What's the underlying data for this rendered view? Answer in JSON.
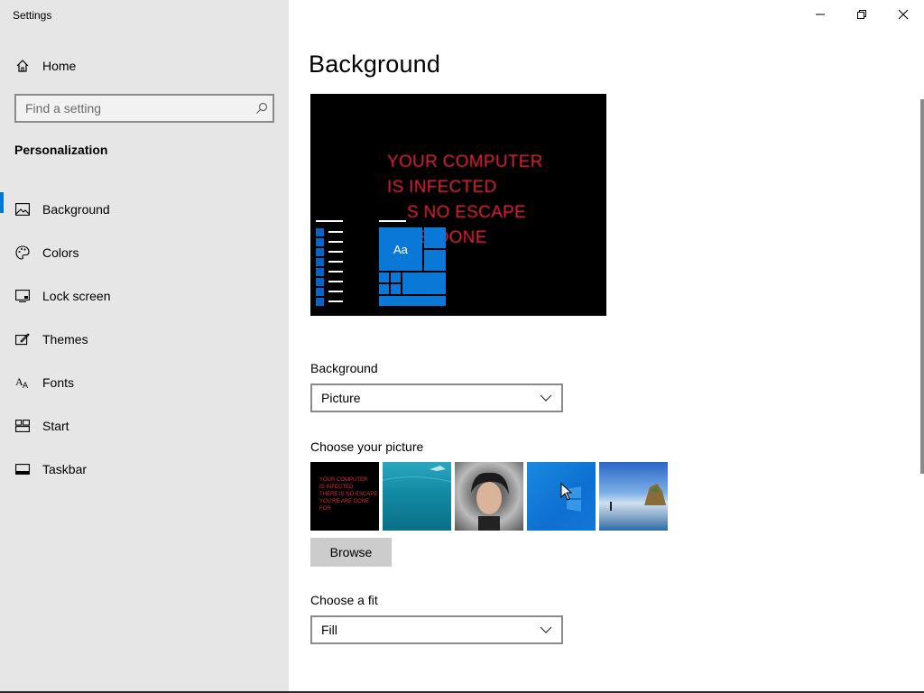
{
  "app": {
    "title": "Settings"
  },
  "sidebar": {
    "home_label": "Home",
    "search_placeholder": "Find a setting",
    "section_title": "Personalization",
    "items": [
      {
        "label": "Background",
        "icon": "picture-icon",
        "active": true
      },
      {
        "label": "Colors",
        "icon": "palette-icon"
      },
      {
        "label": "Lock screen",
        "icon": "lock-screen-icon"
      },
      {
        "label": "Themes",
        "icon": "themes-icon"
      },
      {
        "label": "Fonts",
        "icon": "fonts-icon"
      },
      {
        "label": "Start",
        "icon": "start-icon"
      },
      {
        "label": "Taskbar",
        "icon": "taskbar-icon"
      }
    ]
  },
  "main": {
    "title": "Background",
    "preview": {
      "lines": [
        "YOUR COMPUTER",
        "IS INFECTED",
        "S NO ESCAPE",
        "RE DONE"
      ],
      "tile_label": "Aa"
    },
    "background_label": "Background",
    "background_value": "Picture",
    "choose_picture_label": "Choose your picture",
    "thumb1_text": [
      "YOUR COMPUTER",
      "IS INFECTED",
      "THERE IS NO ESCAPE",
      "YOU'RE ARE DONE",
      "FOR"
    ],
    "browse_label": "Browse",
    "choose_fit_label": "Choose a fit",
    "fit_value": "Fill"
  },
  "colors": {
    "accent": "#0078d7",
    "sidebar_bg": "#e6e6e6",
    "preview_text": "#e0283a"
  }
}
